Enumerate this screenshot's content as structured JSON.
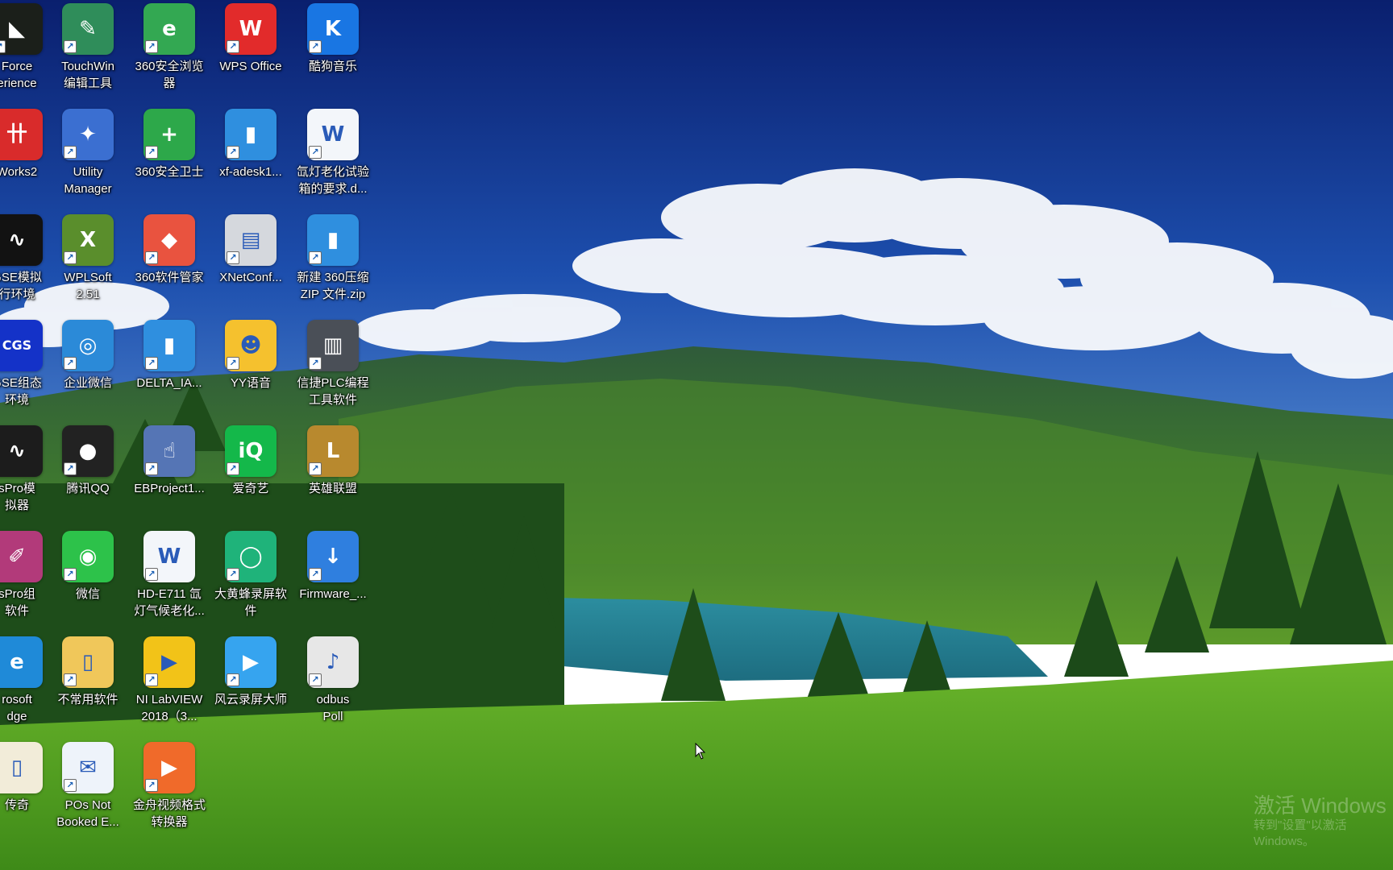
{
  "desktop": {
    "icons": [
      {
        "label": "Force\nerience",
        "icon": "geforce-experience-icon",
        "color": "#1b1f1a"
      },
      {
        "label": "TouchWin\n编辑工具",
        "icon": "touchwin-icon",
        "color": "#2f8d5a"
      },
      {
        "label": "360安全浏览\n器",
        "icon": "360-browser-icon",
        "color": "#33a852"
      },
      {
        "label": "WPS Office",
        "icon": "wps-office-icon",
        "color": "#e22b2b"
      },
      {
        "label": "酷狗音乐",
        "icon": "kugou-music-icon",
        "color": "#1976e3"
      },
      {
        "label": "Works2",
        "icon": "works2-icon",
        "color": "#d92b2b"
      },
      {
        "label": "Utility\nManager",
        "icon": "utility-manager-icon",
        "color": "#3b6fd1"
      },
      {
        "label": "360安全卫士",
        "icon": "360-security-icon",
        "color": "#2da84a"
      },
      {
        "label": "xf-adesk1...",
        "icon": "archive-folder-icon",
        "color": "#2f8fdf"
      },
      {
        "label": "氙灯老化试验\n箱的要求.d...",
        "icon": "word-document-icon",
        "color": "#f3f6fa"
      },
      {
        "label": "GSE模拟\n行环境",
        "icon": "gse-simulator-icon",
        "color": "#121212"
      },
      {
        "label": "WPLSoft\n2.51",
        "icon": "wplsoft-icon",
        "color": "#5a8e2c"
      },
      {
        "label": "360软件管家",
        "icon": "360-software-manager-icon",
        "color": "#e9533f"
      },
      {
        "label": "XNetConf...",
        "icon": "xnetconf-icon",
        "color": "#d5d8dd"
      },
      {
        "label": "新建 360压缩\nZIP 文件.zip",
        "icon": "zip-archive-icon",
        "color": "#2f8fdf"
      },
      {
        "label": "GSE组态\n环境",
        "icon": "gse-config-icon",
        "color": "#1432c8"
      },
      {
        "label": "企业微信",
        "icon": "wecom-icon",
        "color": "#2b8ad8"
      },
      {
        "label": "DELTA_IA...",
        "icon": "delta-folder-icon",
        "color": "#2f8fdf"
      },
      {
        "label": "YY语音",
        "icon": "yy-voice-icon",
        "color": "#f5c12e"
      },
      {
        "label": "信捷PLC编程\n工具软件",
        "icon": "xinje-plc-icon",
        "color": "#4a4f57"
      },
      {
        "label": "sPro模\n拟器",
        "icon": "gxpro-simulator-icon",
        "color": "#1c1c1c"
      },
      {
        "label": "腾讯QQ",
        "icon": "qq-penguin-icon",
        "color": "#222222"
      },
      {
        "label": "EBProject1...",
        "icon": "ebproject-icon",
        "color": "#5575b5"
      },
      {
        "label": "爱奇艺",
        "icon": "iqiyi-icon",
        "color": "#14b84a"
      },
      {
        "label": "英雄联盟",
        "icon": "league-of-legends-icon",
        "color": "#b8892e"
      },
      {
        "label": "sPro组\n软件",
        "icon": "gxpro-config-icon",
        "color": "#b23a7a"
      },
      {
        "label": "微信",
        "icon": "wechat-icon",
        "color": "#2dc24a"
      },
      {
        "label": "HD-E711 氙\n灯气候老化...",
        "icon": "word-document-icon",
        "color": "#f3f6fa"
      },
      {
        "label": "大黄蜂录屏软\n件",
        "icon": "bumblebee-recorder-icon",
        "color": "#1fb37a"
      },
      {
        "label": "Firmware_...",
        "icon": "firmware-download-icon",
        "color": "#2f7fdf"
      },
      {
        "label": "rosoft\ndge",
        "icon": "microsoft-edge-icon",
        "color": "#1f8ad8"
      },
      {
        "label": "不常用软件",
        "icon": "folder-icon",
        "color": "#f0c75a"
      },
      {
        "label": "NI LabVIEW\n2018（3...",
        "icon": "labview-icon",
        "color": "#f2c318"
      },
      {
        "label": "风云录屏大师",
        "icon": "fengyun-recorder-icon",
        "color": "#36a4ef"
      },
      {
        "label": "odbus\nPoll",
        "icon": "modbus-poll-icon",
        "color": "#e7e7e7"
      },
      {
        "label": "传奇",
        "icon": "text-file-icon",
        "color": "#f2ecd9"
      },
      {
        "label": "POs Not\nBooked E...",
        "icon": "email-document-icon",
        "color": "#eef3fa"
      },
      {
        "label": "金舟视频格式\n转换器",
        "icon": "video-converter-icon",
        "color": "#f06a2a"
      }
    ],
    "watermark": {
      "line1": "激活 Windows",
      "line2": "转到\"设置\"以激活 Windows。"
    }
  }
}
